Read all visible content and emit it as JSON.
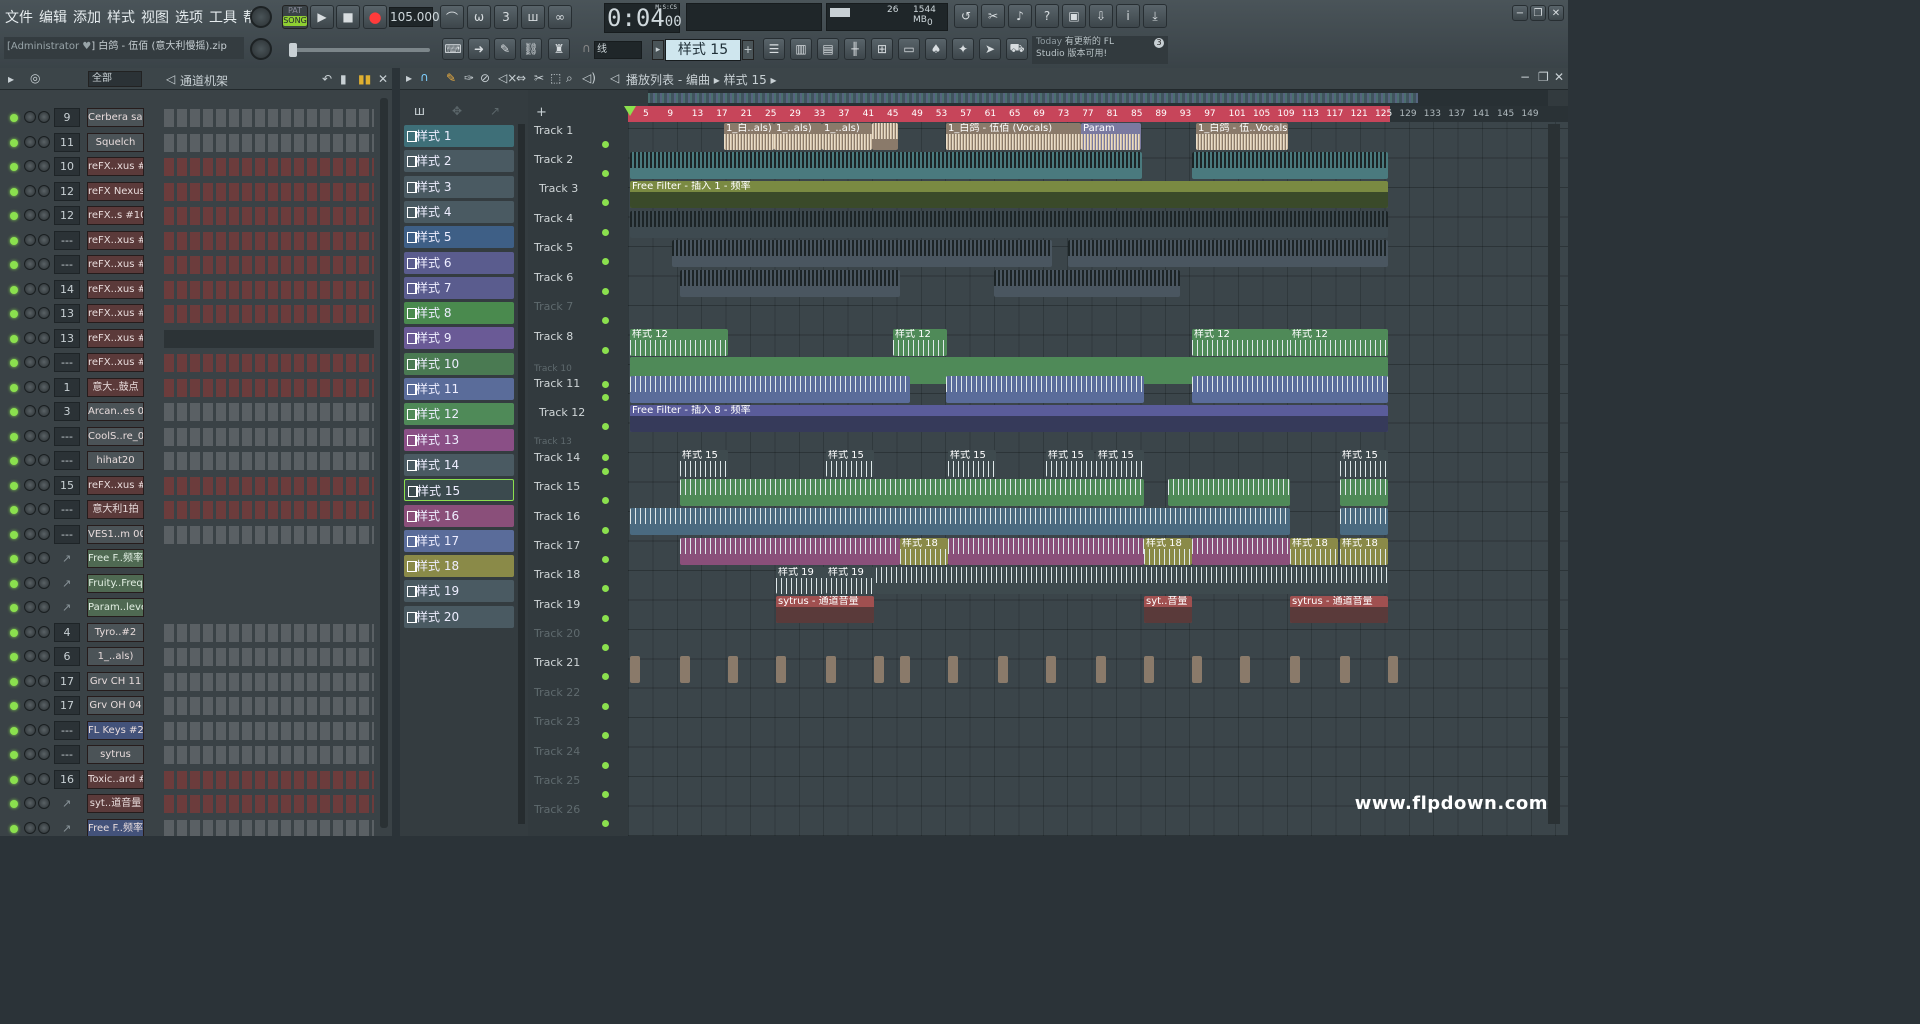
{
  "menu": [
    "文件",
    "编辑",
    "添加",
    "样式",
    "视图",
    "选项",
    "工具",
    "帮助"
  ],
  "transport": {
    "pat_label": "PAT",
    "song_label": "SONG",
    "tempo": "105.000",
    "time": "0:04",
    "time_small": "00",
    "time_unit": "M:S:CS",
    "cpu": "26",
    "mem": "1544 MB",
    "voices": "0"
  },
  "project": {
    "user": "[Administrator ♥",
    "file": "] 白鸽 - 伍佰 (意大利慢摇).zip"
  },
  "snap": "线",
  "pattern_selector": "样式 15",
  "news": {
    "today": "Today",
    "line1": "有更新的 FL",
    "line2": "Studio 版本可用!",
    "count": "3"
  },
  "rack": {
    "filter": "全部",
    "title": "通道机架",
    "channels": [
      {
        "num": "9",
        "name": "Cerbera saw",
        "kind": "grey"
      },
      {
        "num": "11",
        "name": "Squelch",
        "kind": "grey"
      },
      {
        "num": "10",
        "name": "reFX..xus #9",
        "kind": "red"
      },
      {
        "num": "12",
        "name": "reFX Nexus",
        "kind": "red"
      },
      {
        "num": "12",
        "name": "reFX..s #10",
        "kind": "red"
      },
      {
        "num": "---",
        "name": "reFX..xus #2",
        "kind": "red"
      },
      {
        "num": "---",
        "name": "reFX..xus #3",
        "kind": "red"
      },
      {
        "num": "14",
        "name": "reFX..xus #5",
        "kind": "red"
      },
      {
        "num": "13",
        "name": "reFX..xus #4",
        "kind": "red"
      },
      {
        "num": "13",
        "name": "reFX..xus #8",
        "kind": "red"
      },
      {
        "num": "---",
        "name": "reFX..xus #6",
        "kind": "red"
      },
      {
        "num": "1",
        "name": "意大..鼓点",
        "kind": "red"
      },
      {
        "num": "3",
        "name": "Arcan..es 03",
        "kind": "grey"
      },
      {
        "num": "---",
        "name": "CoolS..re_01",
        "kind": "grey"
      },
      {
        "num": "---",
        "name": "hihat20",
        "kind": "grey"
      },
      {
        "num": "15",
        "name": "reFX..xus #7",
        "kind": "red"
      },
      {
        "num": "---",
        "name": "意大利1拍",
        "kind": "red"
      },
      {
        "num": "---",
        "name": "VES1..m 005",
        "kind": "grey"
      },
      {
        "num": "",
        "name": "Free F..频率",
        "kind": "aut"
      },
      {
        "num": "",
        "name": "Fruity..Freq",
        "kind": "aut"
      },
      {
        "num": "",
        "name": "Param..level",
        "kind": "aut"
      },
      {
        "num": "4",
        "name": "Tyro..#2",
        "kind": "grey"
      },
      {
        "num": "6",
        "name": "1_..als)",
        "kind": "grey"
      },
      {
        "num": "17",
        "name": "Grv CH 11",
        "kind": "grey"
      },
      {
        "num": "17",
        "name": "Grv OH 04",
        "kind": "grey"
      },
      {
        "num": "---",
        "name": "FL Keys #2",
        "kind": "blu"
      },
      {
        "num": "---",
        "name": "sytrus",
        "kind": "grey"
      },
      {
        "num": "16",
        "name": "Toxic..ard #2",
        "kind": "red"
      },
      {
        "num": "",
        "name": "syt..道音量",
        "kind": "red"
      },
      {
        "num": "",
        "name": "Free F..频率",
        "kind": "blu"
      }
    ]
  },
  "patterns": [
    {
      "name": "样式 1",
      "color": "#3e6f78"
    },
    {
      "name": "样式 2",
      "color": "#4a5a62"
    },
    {
      "name": "样式 3",
      "color": "#4a5a62"
    },
    {
      "name": "样式 4",
      "color": "#4a5a62"
    },
    {
      "name": "样式 5",
      "color": "#3e5f86"
    },
    {
      "name": "样式 6",
      "color": "#5a5c8e"
    },
    {
      "name": "样式 7",
      "color": "#5a5c8e"
    },
    {
      "name": "样式 8",
      "color": "#4a8a4e"
    },
    {
      "name": "样式 9",
      "color": "#6a5a96"
    },
    {
      "name": "样式 10",
      "color": "#4a7a52"
    },
    {
      "name": "样式 11",
      "color": "#5a6c9a"
    },
    {
      "name": "样式 12",
      "color": "#4f8a58"
    },
    {
      "name": "样式 13",
      "color": "#8a4f86"
    },
    {
      "name": "样式 14",
      "color": "#4a5a62"
    },
    {
      "name": "样式 15",
      "color": "#3b4a4e"
    },
    {
      "name": "样式 16",
      "color": "#8a4f7a"
    },
    {
      "name": "样式 17",
      "color": "#5a6c9a"
    },
    {
      "name": "样式 18",
      "color": "#8a8a48"
    },
    {
      "name": "样式 19",
      "color": "#4a5a62"
    },
    {
      "name": "样式 20",
      "color": "#4a5a62"
    }
  ],
  "playlist": {
    "title": "播放列表 - 编曲",
    "crumb": "样式 15",
    "ruler": [
      "5",
      "9",
      "13",
      "17",
      "21",
      "25",
      "29",
      "33",
      "37",
      "41",
      "45",
      "49",
      "53",
      "57",
      "61",
      "65",
      "69",
      "73",
      "77",
      "81",
      "85",
      "89",
      "93",
      "97",
      "101",
      "105",
      "109",
      "113",
      "117",
      "121",
      "125",
      "129",
      "133",
      "137",
      "141",
      "145",
      "149"
    ],
    "tracks": [
      "Track 1",
      "Track 2",
      "Track 3",
      "Track 4",
      "Track 5",
      "Track 6",
      "Track 7",
      "Track 8",
      "Track 10",
      "Track 11",
      "Track 12",
      "Track 13",
      "Track 14",
      "Track 15",
      "Track 16",
      "Track 17",
      "Track 18",
      "Track 19",
      "Track 20",
      "Track 21",
      "Track 22",
      "Track 23",
      "Track 24",
      "Track 25",
      "Track 26"
    ],
    "clip_labels": {
      "vocal_a": "1_白..als)",
      "vocal_b": "1_..als)",
      "vocal_c": "1_..als)",
      "vocal_d": "1_白鸽 - 伍佰 (Vocals)",
      "vocal_e": "1_白鸽 - 伍..Vocals)",
      "param": "Param",
      "filter1": "Free Filter - 插入 1 - 频率",
      "filter8": "Free Filter - 插入 8 - 频率",
      "p12": "样式 12",
      "p15": "样式 15",
      "p18": "样式 18",
      "p19": "样式 19",
      "syt1": "sytrus - 通道音量",
      "syt2": "syt..音量"
    }
  },
  "watermark": "www.flpdown.com"
}
